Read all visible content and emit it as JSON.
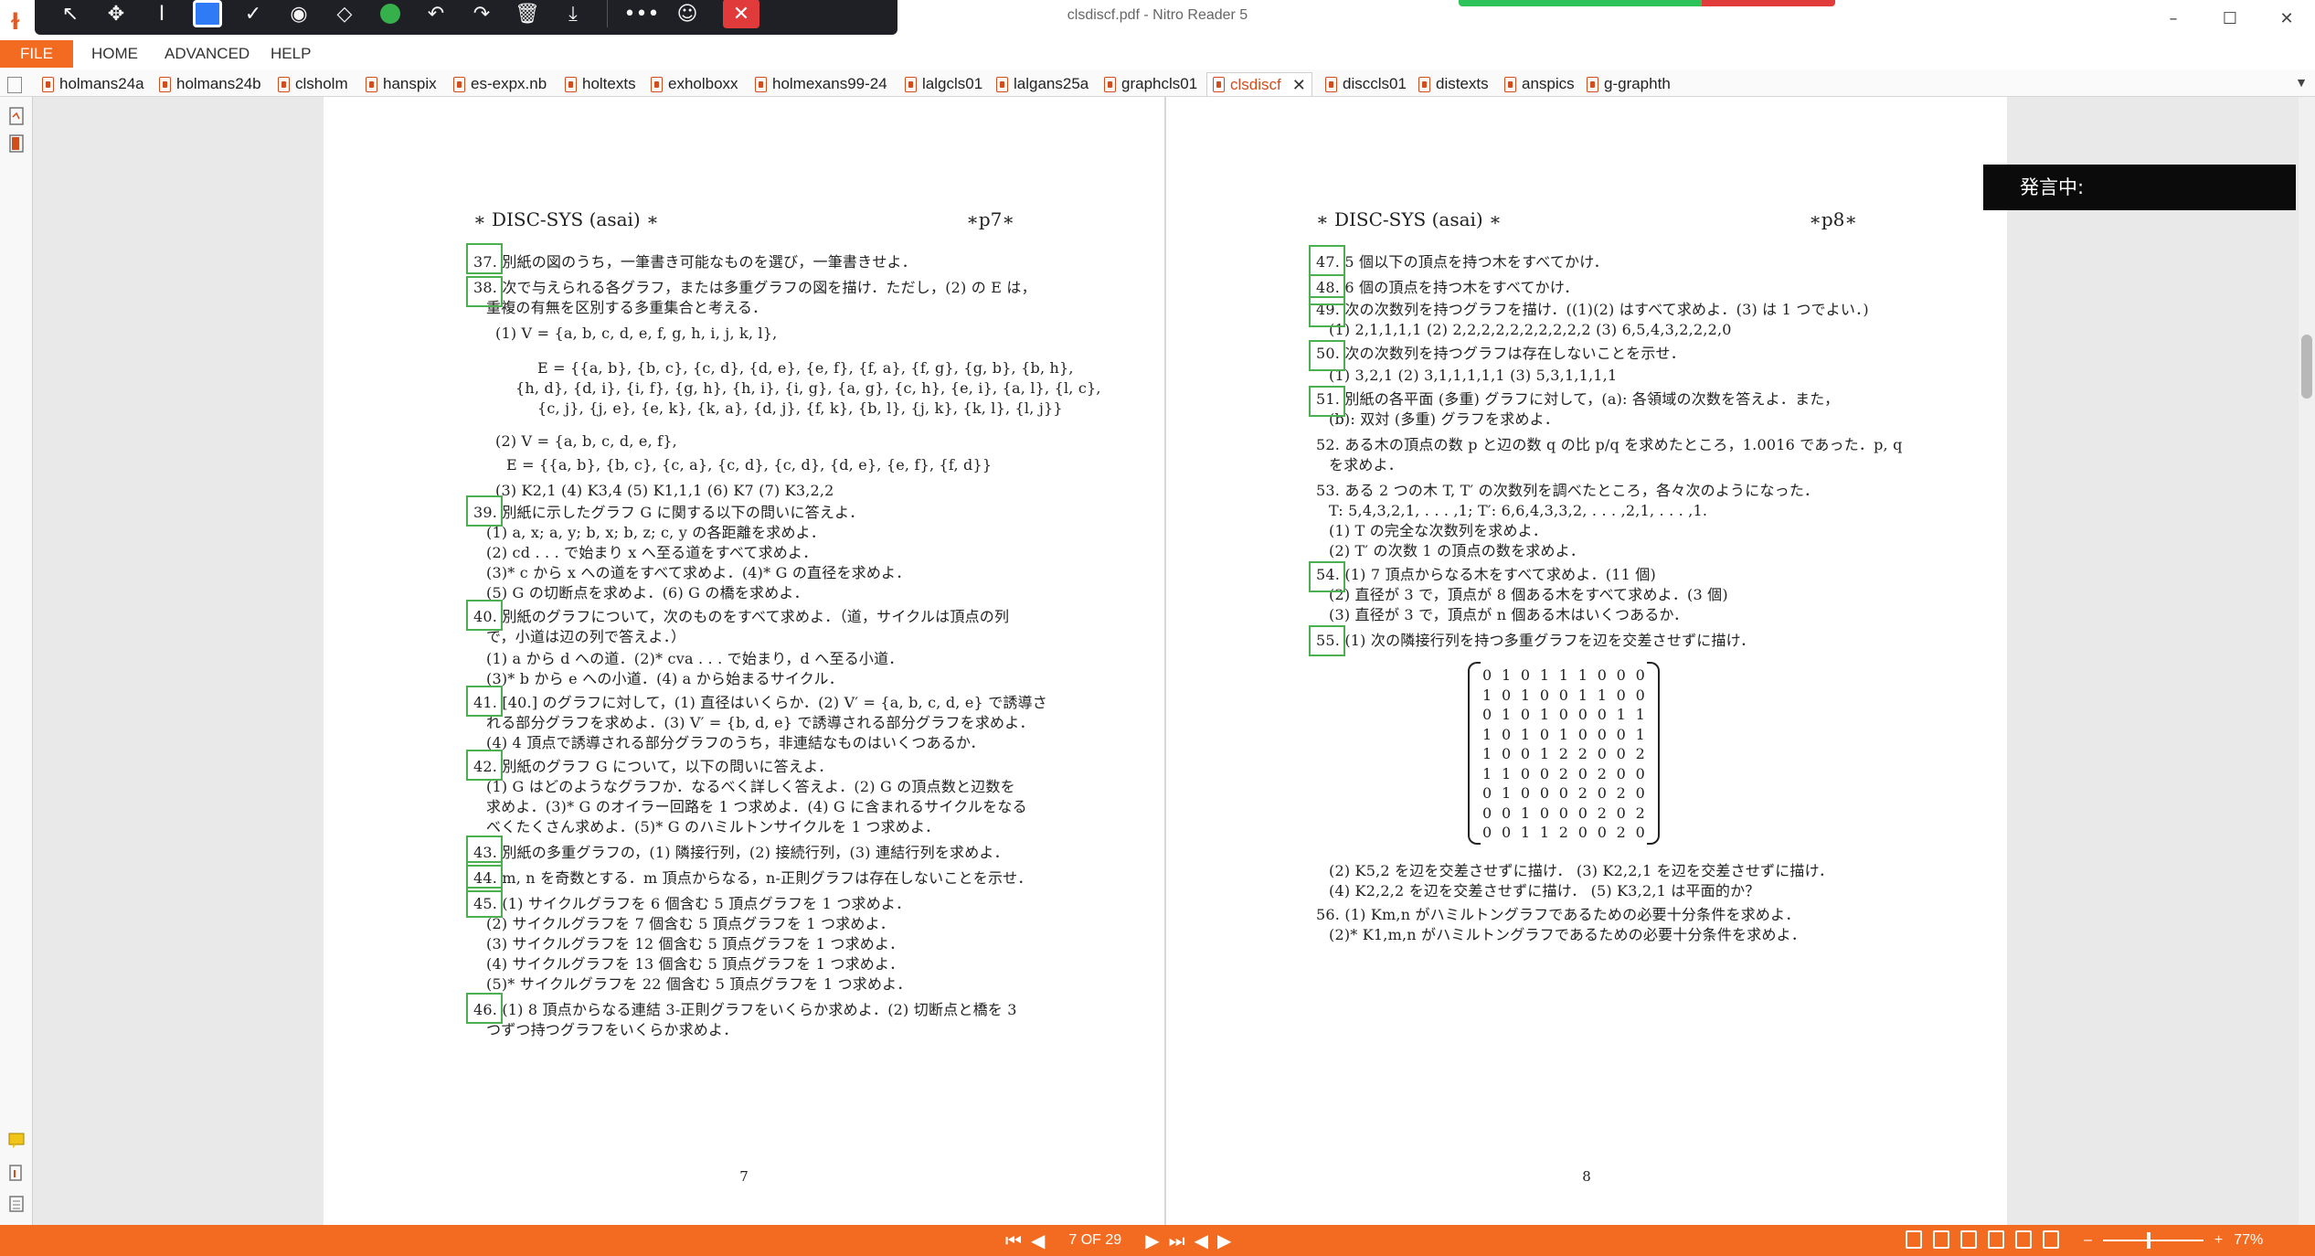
{
  "window": {
    "title": "clsdiscf.pdf - Nitro Reader 5",
    "minimize": "–",
    "maximize": "☐",
    "close": "✕"
  },
  "ribbon": {
    "file": "FILE",
    "tabs": [
      "HOME",
      "ADVANCED",
      "HELP"
    ]
  },
  "doc_tabs": [
    "holmans24a",
    "holmans24b",
    "clsholm",
    "hanspix",
    "es-expx.nb",
    "holtexts",
    "exholboxx",
    "holmexans99-24",
    "lalgcls01",
    "lalgans25a",
    "graphcls01",
    "clsdiscf",
    "disccls01",
    "distexts",
    "anspics",
    "g-graphth"
  ],
  "active_tab": "clsdiscf",
  "overlay": {
    "speaking": "発言中:"
  },
  "page7": {
    "header_left": "∗ DISC-SYS (asai) ∗",
    "header_right": "∗p7∗",
    "page_number": "7",
    "lines": [
      "37. 別紙の図のうち，一筆書き可能なものを選び，一筆書きせよ．",
      "38. 次で与えられる各グラフ，または多重グラフの図を描け．ただし，(2) の E は，",
      "重複の有無を区別する多重集合と考える．",
      "(1)  V = {a, b, c, d, e, f, g, h, i, j, k, l},",
      "E = {{a, b}, {b, c}, {c, d}, {d, e}, {e, f}, {f, a}, {f, g}, {g, b}, {b, h},",
      "{h, d}, {d, i}, {i, f}, {g, h}, {h, i}, {i, g}, {a, g}, {c, h}, {e, i}, {a, l}, {l, c},",
      "{c, j}, {j, e}, {e, k}, {k, a}, {d, j}, {f, k}, {b, l}, {j, k}, {k, l}, {l, j}}",
      "(2)  V = {a, b, c, d, e, f},",
      "E = {{a, b}, {b, c}, {c, a}, {c, d}, {c, d}, {d, e}, {e, f}, {f, d}}",
      "(3)  K2,1    (4)  K3,4    (5)  K1,1,1    (6)  K7    (7)  K3,2,2",
      "39. 別紙に示したグラフ G に関する以下の問いに答えよ．",
      "(1) a, x; a, y; b, x; b, z; c, y の各距離を求めよ．",
      "(2) cd . . . で始まり x へ至る道をすべて求めよ．",
      "(3)* c から x への道をすべて求めよ．(4)* G の直径を求めよ．",
      "(5) G の切断点を求めよ．(6) G の橋を求めよ．",
      "40. 別紙のグラフについて，次のものをすべて求めよ．（道，サイクルは頂点の列",
      "で，小道は辺の列で答えよ．）",
      "(1) a から d への道．(2)* cva . . . で始まり，d へ至る小道．",
      "(3)* b から e への小道．(4) a から始まるサイクル．",
      "41. [40.] のグラフに対して，(1) 直径はいくらか．(2) V′ = {a, b, c, d, e} で誘導さ",
      "れる部分グラフを求めよ．(3) V′ = {b, d, e} で誘導される部分グラフを求めよ．",
      "(4) 4 頂点で誘導される部分グラフのうち，非連結なものはいくつあるか．",
      "42. 別紙のグラフ G について，以下の問いに答えよ．",
      "(1) G はどのようなグラフか．なるべく詳しく答えよ．(2) G の頂点数と辺数を",
      "求めよ．(3)* G のオイラー回路を 1 つ求めよ．(4) G に含まれるサイクルをなる",
      "べくたくさん求めよ．(5)* G のハミルトンサイクルを 1 つ求めよ．",
      "43. 別紙の多重グラフの，(1) 隣接行列，(2) 接続行列，(3) 連結行列を求めよ．",
      "44. m, n を奇数とする．m 頂点からなる，n-正則グラフは存在しないことを示せ．",
      "45. (1) サイクルグラフを 6 個含む 5 頂点グラフを 1 つ求めよ．",
      "(2) サイクルグラフを 7 個含む 5 頂点グラフを 1 つ求めよ．",
      "(3) サイクルグラフを 12 個含む 5 頂点グラフを 1 つ求めよ．",
      "(4) サイクルグラフを 13 個含む 5 頂点グラフを 1 つ求めよ．",
      "(5)* サイクルグラフを 22 個含む 5 頂点グラフを 1 つ求めよ．",
      "46. (1) 8 頂点からなる連結 3-正則グラフをいくらか求めよ．(2) 切断点と橋を 3",
      "つずつ持つグラフをいくらか求めよ．"
    ]
  },
  "page8": {
    "header_left": "∗ DISC-SYS (asai) ∗",
    "header_right": "∗p8∗",
    "page_number": "8",
    "lines": [
      "47. 5 個以下の頂点を持つ木をすべてかけ．",
      "48. 6 個の頂点を持つ木をすべてかけ．",
      "49. 次の次数列を持つグラフを描け．((1)(2) はすべて求めよ．(3) は 1 つでよい．)",
      "(1) 2,1,1,1,1        (2) 2,2,2,2,2,2,2,2,2,2        (3) 6,5,4,3,2,2,2,0",
      "50. 次の次数列を持つグラフは存在しないことを示せ．",
      "(1)  3,2,1        (2)  3,1,1,1,1,1        (3)  5,3,1,1,1,1",
      "51. 別紙の各平面 (多重) グラフに対して，(a): 各領域の次数を答えよ．また，",
      "(b): 双対 (多重) グラフを求めよ．",
      "52. ある木の頂点の数 p と辺の数 q の比 p/q を求めたところ，1.0016 であった．p, q",
      "を求めよ．",
      "53. ある 2 つの木 T, T′ の次数列を調べたところ，各々次のようになった．",
      "T:  5,4,3,2,1, . . . ,1;  T′:  6,6,4,3,3,2, . . . ,2,1, . . . ,1.",
      "(1) T の完全な次数列を求めよ．",
      "(2) T′ の次数 1 の頂点の数を求めよ．",
      "54. (1) 7 頂点からなる木をすべて求めよ．(11 個)",
      "(2) 直径が 3 で，頂点が 8 個ある木をすべて求めよ．(3 個)",
      "(3) 直径が 3 で，頂点が n 個ある木はいくつあるか．",
      "55. (1) 次の隣接行列を持つ多重グラフを辺を交差させずに描け．",
      "(2)  K5,2 を辺を交差させずに描け．    (3)  K2,2,1 を辺を交差させずに描け．",
      "(4)  K2,2,2 を辺を交差させずに描け．    (5)  K3,2,1 は平面的か？",
      "56. (1)  Km,n がハミルトングラフであるための必要十分条件を求めよ．",
      "(2)*  K1,m,n がハミルトングラフであるための必要十分条件を求めよ．"
    ],
    "matrix": [
      "0  1  0  1  1  1  0  0  0",
      "1  0  1  0  0  1  1  0  0",
      "0  1  0  1  0  0  0  1  1",
      "1  0  1  0  1  0  0  0  1",
      "1  0  0  1  2  2  0  0  2",
      "1  1  0  0  2  0  2  0  0",
      "0  1  0  0  0  2  0  2  0",
      "0  0  1  0  0  0  2  0  2",
      "0  0  1  1  2  0  0  2  0"
    ]
  },
  "statusbar": {
    "page_info": "7 OF 29",
    "zoom": "77%",
    "zoom_minus": "–",
    "zoom_plus": "+"
  }
}
